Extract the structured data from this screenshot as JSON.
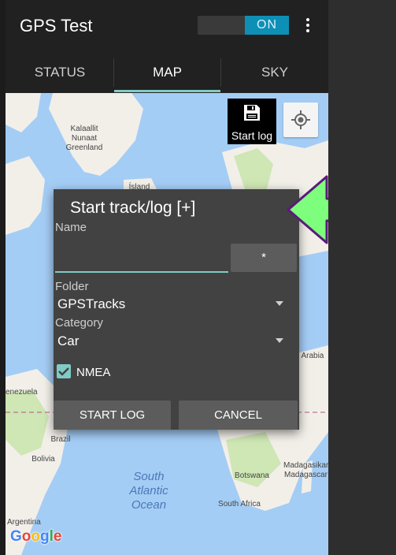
{
  "app": {
    "title": "GPS Test",
    "toggle_label": "ON"
  },
  "tabs": [
    {
      "label": "STATUS",
      "active": false
    },
    {
      "label": "MAP",
      "active": true
    },
    {
      "label": "SKY",
      "active": false
    }
  ],
  "map": {
    "start_log_label": "Start log",
    "places": {
      "greenland": "Kalaallit\nNunaat\nGreenland",
      "island": "Ísland",
      "venezuela": "enezuela",
      "brazil": "Brazil",
      "bolivia": "Bolivia",
      "argentina": "Argentina",
      "saudi": "i Arabia",
      "botswana": "Botswana",
      "south_africa": "South Africa",
      "madagascar": "Madagasikara\nMadagascar"
    },
    "ocean_label": "South\nAtlantic\nOcean",
    "google_logo": "Google",
    "colors": {
      "water": "#a4cdf5",
      "land": "#f2efe9",
      "forest": "#cfe6b5",
      "accent": "#80cbc4"
    }
  },
  "dialog": {
    "title": "Start track/log [+]",
    "name_label": "Name",
    "name_value": "",
    "star_button": "*",
    "folder_label": "Folder",
    "folder_value": "GPSTracks",
    "category_label": "Category",
    "category_value": "Car",
    "nmea_label": "NMEA",
    "nmea_checked": true,
    "start_button": "START LOG",
    "cancel_button": "CANCEL"
  },
  "callout": {
    "icon": "curved-arrow-icon",
    "color": "#7dff7d",
    "border": "#5a1a7a"
  }
}
